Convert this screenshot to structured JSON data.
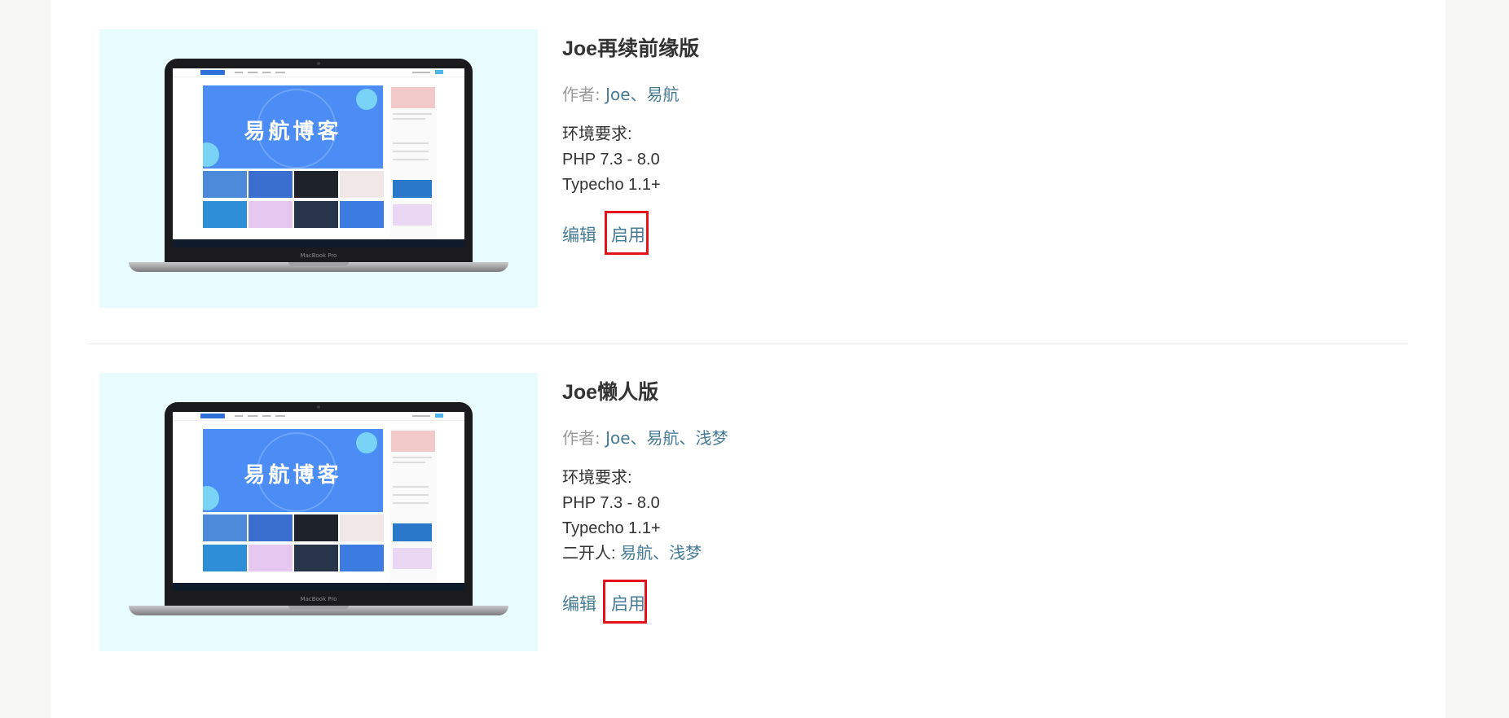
{
  "themes": [
    {
      "name": "Joe再续前缘版",
      "author_label": "作者:",
      "authors": "Joe、易航",
      "requirements_label": "环境要求:",
      "requirements": [
        "PHP 7.3 - 8.0",
        "Typecho 1.1+"
      ],
      "dev_label": "",
      "devs": "",
      "edit_label": "编辑",
      "enable_label": "启用",
      "preview": {
        "banner_text": "易航博客",
        "device_label": "MacBook Pro"
      }
    },
    {
      "name": "Joe懒人版",
      "author_label": "作者:",
      "authors": "Joe、易航、浅梦",
      "requirements_label": "环境要求:",
      "requirements": [
        "PHP 7.3 - 8.0",
        "Typecho 1.1+"
      ],
      "dev_label": "二开人:",
      "devs": "易航、浅梦",
      "edit_label": "编辑",
      "enable_label": "启用",
      "preview": {
        "banner_text": "易航博客",
        "device_label": "MacBook Pro"
      }
    }
  ],
  "colors": {
    "link": "#467b96",
    "highlight": "#e3131b",
    "thumbnail_bg": "#e9fcfd"
  }
}
